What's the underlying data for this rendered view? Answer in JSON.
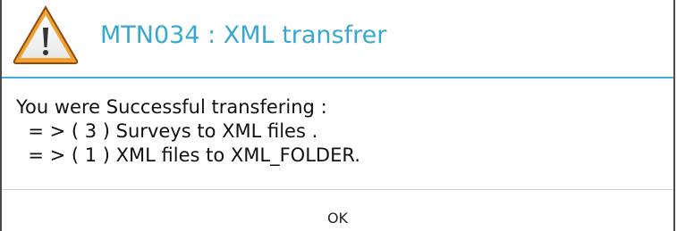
{
  "dialog": {
    "title": "MTN034 : XML transfrer",
    "icon": "warning-icon",
    "message_lines": [
      "You were Successful transfering :",
      "  = > ( 3 ) Surveys to XML files .",
      "  = > ( 1 ) XML files to XML_FOLDER."
    ],
    "ok_label": "OK"
  },
  "colors": {
    "title": "#39a8cf",
    "header_rule": "#3ab0d4",
    "warning_fill": "#f0a030",
    "warning_outline": "#8a4a10"
  }
}
